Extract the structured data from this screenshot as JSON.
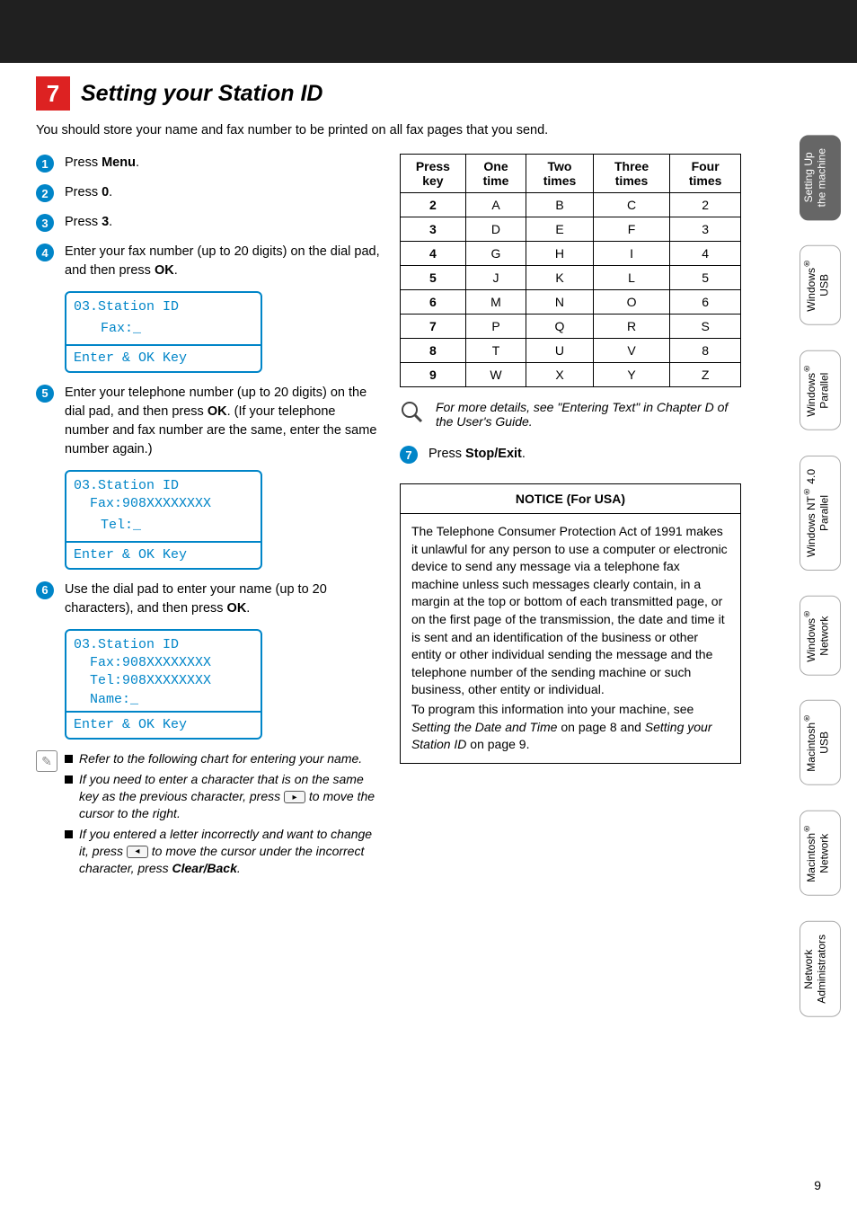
{
  "section": {
    "number": "7",
    "title": "Setting your Station ID"
  },
  "intro": "You should store your name and fax number to be printed on all fax pages that you send.",
  "steps": {
    "s1": "Press Menu.",
    "s2": "Press 0.",
    "s3": "Press 3.",
    "s4": "Enter your fax number (up to 20 digits) on the dial pad, and then press OK.",
    "s5": "Enter your telephone number (up to 20 digits) on the dial pad, and then press OK. (If your telephone number and fax number are the same, enter the same number again.)",
    "s6": "Use the dial pad to enter your name (up to 20 characters), and then press OK.",
    "s7": "Press Stop/Exit."
  },
  "lcd1": {
    "l1": "03.Station ID",
    "l2": "",
    "l3": "  Fax:_",
    "foot": "Enter & OK Key"
  },
  "lcd2": {
    "l1": "03.Station ID",
    "l2": "  Fax:908XXXXXXXX",
    "l3": "  Tel:_",
    "foot": "Enter & OK Key"
  },
  "lcd3": {
    "l1": "03.Station ID",
    "l2": "  Fax:908XXXXXXXX",
    "l3": "  Tel:908XXXXXXXX",
    "l4": "  Name:_",
    "foot": "Enter & OK Key"
  },
  "notes": {
    "n1": "Refer to the following chart for entering your name.",
    "n2a": "If you need to enter a character that is on the same key as the previous character, press ",
    "n2b": " to move the cursor to the right.",
    "n3a": "If you entered a letter incorrectly and want to change it, press ",
    "n3b": " to move the cursor under the incorrect character, press Clear/Back.",
    "arrow_right": "▸",
    "arrow_left": "◂"
  },
  "chart_data": {
    "type": "table",
    "headers": [
      "Press key",
      "One time",
      "Two times",
      "Three times",
      "Four times"
    ],
    "rows": [
      [
        "2",
        "A",
        "B",
        "C",
        "2"
      ],
      [
        "3",
        "D",
        "E",
        "F",
        "3"
      ],
      [
        "4",
        "G",
        "H",
        "I",
        "4"
      ],
      [
        "5",
        "J",
        "K",
        "L",
        "5"
      ],
      [
        "6",
        "M",
        "N",
        "O",
        "6"
      ],
      [
        "7",
        "P",
        "Q",
        "R",
        "S"
      ],
      [
        "8",
        "T",
        "U",
        "V",
        "8"
      ],
      [
        "9",
        "W",
        "X",
        "Y",
        "Z"
      ]
    ]
  },
  "info": "For more details, see \"Entering Text\" in Chapter D of the User's Guide.",
  "notice": {
    "title": "NOTICE (For USA)",
    "p1": "The Telephone Consumer Protection Act of 1991 makes it unlawful for any person to use a computer or electronic device to send any message via a telephone fax machine unless such messages clearly contain, in a margin at the top or bottom of each transmitted page, or on the first page of the transmission, the date and time it is sent and an identification of the business or other entity or other individual sending the message and the telephone number of the sending machine or such business, other entity or individual.",
    "p2": "To program this information into your machine, see Setting the Date and Time on page 8 and Setting your Station ID on page 9."
  },
  "tabs": {
    "t1a": "Setting Up",
    "t1b": "the machine",
    "t2a": "Windows",
    "t2b": "USB",
    "t3a": "Windows",
    "t3b": "Parallel",
    "t4a": "Windows NT",
    "t4a2": " 4.0",
    "t4b": "Parallel",
    "t5a": "Windows",
    "t5b": "Network",
    "t6a": "Macintosh",
    "t6b": "USB",
    "t7a": "Macintosh",
    "t7b": "Network",
    "t8a": "Network",
    "t8b": "Administrators"
  },
  "page": "9"
}
